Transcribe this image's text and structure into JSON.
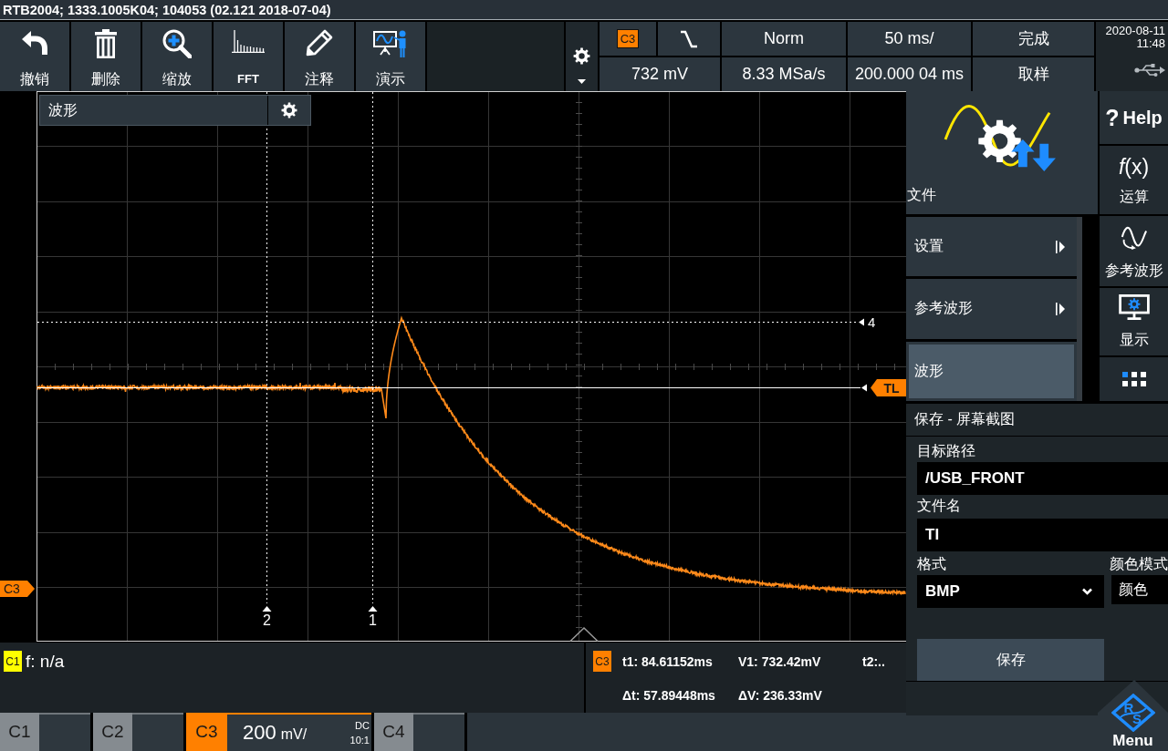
{
  "window": {
    "title": "RTB2004; 1333.1005K04; 104053 (02.121 2018-07-04)"
  },
  "toolbar": [
    {
      "kind": "undo",
      "label": "撤销"
    },
    {
      "kind": "delete",
      "label": "删除"
    },
    {
      "kind": "zoom",
      "label": "缩放"
    },
    {
      "kind": "fft",
      "label": "FFT"
    },
    {
      "kind": "annotate",
      "label": "注释"
    },
    {
      "kind": "present",
      "label": "演示"
    }
  ],
  "acquisition": {
    "source": {
      "label": "C3",
      "color": "#ff8000"
    },
    "trigger_mode": "Norm",
    "time_scale": "50 ms/",
    "run_state": "完成",
    "trigger_level": "732 mV",
    "sample_rate": "8.33 MSa/s",
    "time_position": "200.000 04 ms",
    "acquire_mode": "取样"
  },
  "clock": {
    "date": "2020-08-11",
    "time": "11:48"
  },
  "waveform_view": {
    "title": "波形",
    "vertical_cursors": [
      {
        "label": "2"
      },
      {
        "label": "1"
      }
    ],
    "horizontal_cursor": {
      "label": "4"
    },
    "trigger_level_tag": "TL",
    "channel_marker": "C3"
  },
  "frequency_readout": {
    "channel": "C1",
    "color": "#ffff00",
    "text": "f: n/a"
  },
  "cursor_readout": {
    "channel": "C3",
    "color": "#ff8000",
    "values": [
      "t1: 84.61152ms",
      "V1: 732.42mV",
      "t2:..",
      "Δt: 57.89448ms",
      "ΔV: 236.33mV"
    ]
  },
  "channels": [
    {
      "label": "C1",
      "active": false
    },
    {
      "label": "C2",
      "active": false
    },
    {
      "label": "C3",
      "active": true,
      "scale": "200",
      "unit": "mV/",
      "coupling": "DC",
      "probe": "10:1"
    },
    {
      "label": "C4",
      "active": false
    }
  ],
  "file_menu": {
    "title": "文件",
    "items": [
      {
        "label": "设置",
        "submenu": true,
        "selected": false
      },
      {
        "label": "参考波形",
        "submenu": true,
        "selected": false
      },
      {
        "label": "波形",
        "submenu": false,
        "selected": true
      }
    ]
  },
  "side_buttons": [
    {
      "kind": "help",
      "glyph": "?",
      "label": "Help"
    },
    {
      "kind": "math",
      "glyph": "*f*(x)",
      "label": "运算"
    },
    {
      "kind": "reference",
      "label": "参考波形"
    },
    {
      "kind": "display",
      "label": "显示"
    },
    {
      "kind": "apps"
    }
  ],
  "save_dialog": {
    "title": "保存 - 屏幕截图",
    "fields": [
      {
        "label": "目标路径",
        "value": "/USB_FRONT"
      },
      {
        "label": "文件名",
        "value": "TI"
      }
    ],
    "format": {
      "label": "格式",
      "value": "BMP"
    },
    "color_mode": {
      "label": "颜色模式",
      "value": "颜色"
    },
    "button": "保存"
  },
  "menu_button": {
    "logo_letters": [
      "R",
      "S"
    ],
    "label": "Menu"
  }
}
